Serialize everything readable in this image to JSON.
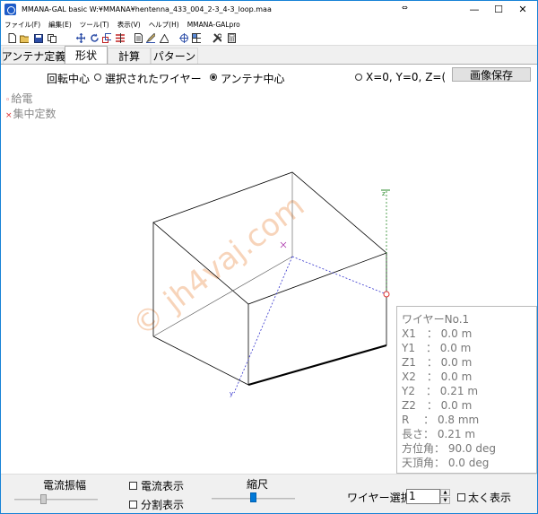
{
  "window": {
    "title": "MMANA-GAL basic W:¥MMANA¥hentenna_433_004_2-3_4-3_loop.maa",
    "arrows": "⇔",
    "minimize": "—",
    "maximize": "☐",
    "close": "✕"
  },
  "menu": [
    "ファイル(F)",
    "編集(E)",
    "ツール(T)",
    "表示(V)",
    "ヘルプ(H)",
    "MMANA-GALpro"
  ],
  "toolbar": {
    "icons": [
      "new-file-icon",
      "open-folder-icon",
      "save-icon",
      "copy-icon",
      "move-icon",
      "rotate-icon",
      "scale-icon",
      "wire-list-icon",
      "document-icon",
      "edit-icon",
      "triangle-icon",
      "target-icon",
      "grid-icon",
      "tools-icon",
      "calculator-icon"
    ]
  },
  "tabs": [
    "アンテナ定義",
    "形状",
    "計算",
    "パターン"
  ],
  "active_tab": 1,
  "options": {
    "rotation_center": "回転中心",
    "selected_wire": "選択されたワイヤー",
    "antenna_center": "アンテナ中心",
    "coords": "X=0, Y=0, Z=(",
    "save_image": "画像保存"
  },
  "legend": {
    "feed": "給電",
    "feed_marker": "◦",
    "lumped": "集中定数",
    "lumped_marker": "×"
  },
  "watermark": "© jh4vaj.com",
  "axis_labels": {
    "y": "y",
    "z": "z"
  },
  "wire_info": [
    "ワイヤーNo.1",
    "X1　：  0.0 m",
    "Y1　：  0.0 m",
    "Z1　：  0.0 m",
    "X2　：  0.0 m",
    "Y2　：  0.21 m",
    "Z2　：  0.0 m",
    "R　 ：  0.8 mm",
    "長さ：  0.21 m",
    "方位角：  90.0 deg",
    "天頂角：  0.0 deg"
  ],
  "bottom": {
    "current_amplitude": "電流振幅",
    "show_current": "電流表示",
    "show_segments": "分割表示",
    "scale": "縮尺",
    "wire_select": "ワイヤー選択",
    "wire_select_value": "1",
    "bold_display": "太く表示",
    "spin_up": "▲",
    "spin_down": "▼"
  },
  "colors": {
    "accent": "#0078d7",
    "feed_marker": "#dd3333",
    "watermark": "#f2b183",
    "axis_blue": "#3333cc",
    "axis_green": "#2a8a2a"
  }
}
